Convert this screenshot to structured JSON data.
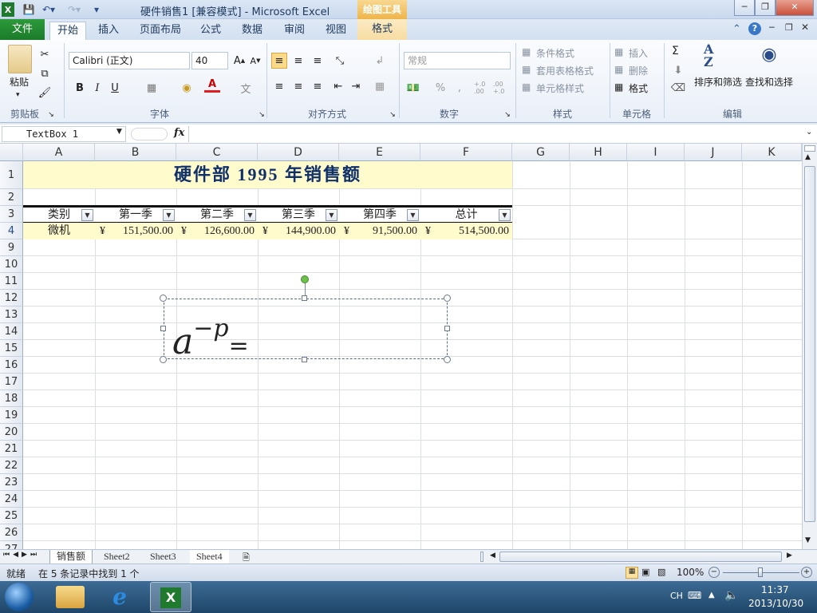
{
  "window": {
    "title": "硬件销售1  [兼容模式] - Microsoft Excel",
    "contextual_group": "绘图工具",
    "contextual_tab": "格式"
  },
  "tabs": [
    "文件",
    "开始",
    "插入",
    "页面布局",
    "公式",
    "数据",
    "审阅",
    "视图"
  ],
  "ribbon": {
    "clipboard": {
      "paste": "粘贴",
      "label": "剪贴板"
    },
    "font": {
      "name": "Calibri (正文)",
      "size": "40",
      "bold": "B",
      "italic": "I",
      "underline": "U",
      "label": "字体"
    },
    "alignment": {
      "label": "对齐方式"
    },
    "number": {
      "format": "常规",
      "percent": "%",
      "comma": ",",
      "inc_decimal": "+.0 .00",
      "dec_decimal": ".00 +.0",
      "label": "数字"
    },
    "styles": {
      "conditional": "条件格式",
      "table": "套用表格格式",
      "cell": "单元格样式",
      "label": "样式"
    },
    "cells": {
      "insert": "插入",
      "delete": "删除",
      "format": "格式",
      "label": "单元格"
    },
    "editing": {
      "sigma": "Σ",
      "sort": "排序和筛选",
      "find": "查找和选择",
      "label": "编辑"
    }
  },
  "formula_bar": {
    "name_box": "TextBox 1",
    "fx": "fx",
    "content": ""
  },
  "sheet": {
    "columns": [
      "A",
      "B",
      "C",
      "D",
      "E",
      "F",
      "G",
      "H",
      "I",
      "J",
      "K"
    ],
    "rows": [
      "1",
      "2",
      "3",
      "4",
      "9",
      "10",
      "11",
      "12",
      "13",
      "14",
      "15",
      "16",
      "17",
      "18",
      "19",
      "20",
      "21",
      "22",
      "23",
      "24",
      "25",
      "26",
      "27"
    ],
    "title": "硬件部 1995 年销售额",
    "headers": [
      "类别",
      "第一季",
      "第二季",
      "第三季",
      "第四季",
      "总计"
    ],
    "data_row": {
      "category": "微机",
      "currency": "¥",
      "values": [
        "151,500.00",
        "126,600.00",
        "144,900.00",
        "91,500.00",
        "514,500.00"
      ]
    }
  },
  "textbox": {
    "base": "a",
    "exponent": "−p",
    "equals": "="
  },
  "sheet_tabs": [
    "销售额",
    "Sheet2",
    "Sheet3",
    "Sheet4"
  ],
  "status": {
    "ready": "就绪",
    "message": "在 5 条记录中找到 1 个",
    "zoom": "100%"
  },
  "taskbar": {
    "lang": "CH",
    "time": "11:37",
    "date": "2013/10/30"
  }
}
